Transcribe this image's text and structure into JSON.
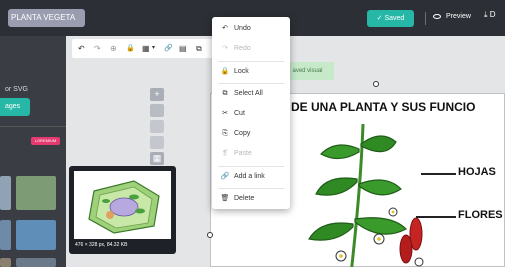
{
  "header": {
    "doc_title": "PLANTA VEGETA",
    "saved_label": "✓ Saved",
    "preview_label": "Preview",
    "download_label": "D"
  },
  "left_panel": {
    "svg_text": "or SVG",
    "images_button": "ages",
    "premium_badge": "LOREMIUM"
  },
  "toolbar": {
    "undo": "↶",
    "redo": "↷",
    "link": "⊕",
    "lock": "🔒",
    "pattern": "▦",
    "chain": "🔗",
    "grid": "▤",
    "more": "⧉"
  },
  "notice": {
    "saved_visual": "aved visual"
  },
  "context_menu": {
    "items": [
      {
        "label": "Undo",
        "icon": "↶",
        "enabled": true
      },
      {
        "label": "Redo",
        "icon": "↷",
        "enabled": false
      },
      {
        "label": "Lock",
        "icon": "🔒",
        "enabled": true
      },
      {
        "label": "Select All",
        "icon": "⧉",
        "enabled": true
      },
      {
        "label": "Cut",
        "icon": "✂",
        "enabled": true
      },
      {
        "label": "Copy",
        "icon": "⎘",
        "enabled": true
      },
      {
        "label": "Paste",
        "icon": "❡",
        "enabled": false
      },
      {
        "label": "Add a link",
        "icon": "🔗",
        "enabled": true
      },
      {
        "label": "Delete",
        "icon": "🗑",
        "enabled": true
      }
    ]
  },
  "canvas": {
    "title": "DE UNA PLANTA Y SUS FUNCIO",
    "labels": {
      "leaves": "HOJAS",
      "flowers": "FLORES"
    }
  },
  "preview_card": {
    "meta": "476 × 328 px, 84.32 KB"
  },
  "colors": {
    "accent": "#27b7a6",
    "topbar": "#2c2f35",
    "badge": "#e6396f"
  }
}
